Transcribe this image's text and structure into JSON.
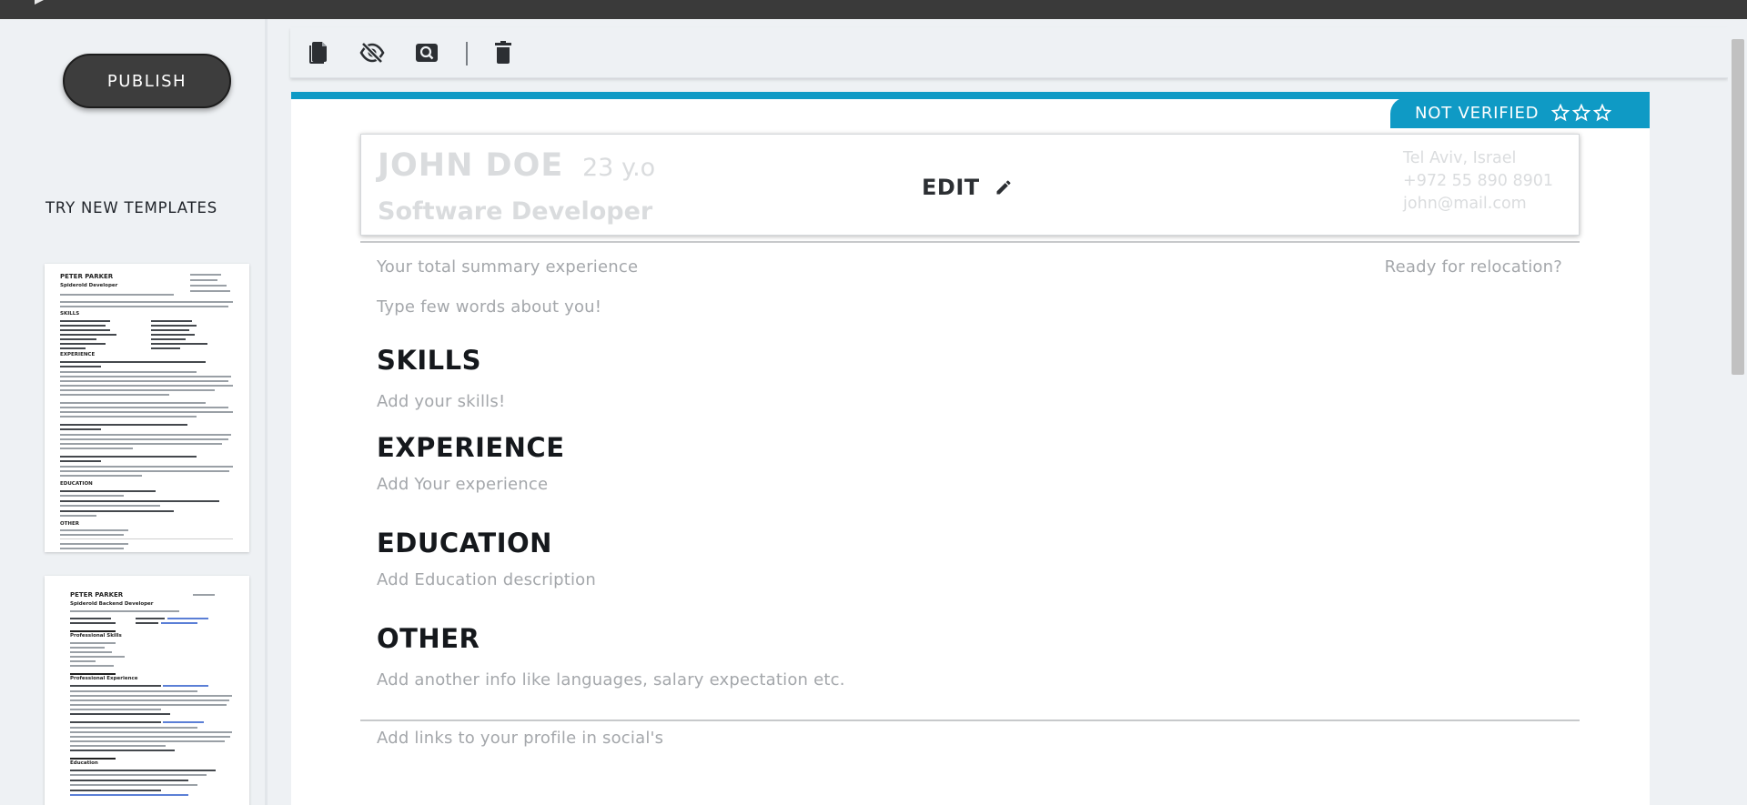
{
  "sidebar": {
    "publish_label": "PUBLISH",
    "templates_heading": "TRY NEW TEMPLATES",
    "templates": [
      {
        "name": "PETER PARKER",
        "role": "Spiderold Developer",
        "sections": [
          "SKILLS",
          "EXPERIENCE",
          "EDUCATION",
          "OTHER"
        ]
      },
      {
        "name": "PETER PARKER",
        "role": "Spiderold Backend Developer",
        "sections": [
          "Professional Skills",
          "Professional Experience",
          "Education"
        ]
      }
    ]
  },
  "toolbar": {
    "icons": [
      "copy-icon",
      "eye-off-icon",
      "search-icon",
      "trash-icon"
    ]
  },
  "resume": {
    "verification": "NOT VERIFIED",
    "star_count": 3,
    "header": {
      "name": "JOHN DOE",
      "age": "23 y.o",
      "title": "Software Developer",
      "edit_label": "EDIT",
      "location": "Tel Aviv, Israel",
      "phone": "+972 55 890 8901",
      "email": "john@mail.com"
    },
    "summary_placeholder": "Your total summary experience",
    "relocation_placeholder": "Ready for relocation?",
    "about_placeholder": "Type few words about you!",
    "sections": {
      "skills": {
        "title": "SKILLS",
        "placeholder": "Add your skills!"
      },
      "experience": {
        "title": "EXPERIENCE",
        "placeholder": "Add Your experience"
      },
      "education": {
        "title": "EDUCATION",
        "placeholder": "Add Education description"
      },
      "other": {
        "title": "OTHER",
        "placeholder": "Add another info like languages, salary expectation etc."
      }
    },
    "links_placeholder": "Add links to your profile in social's"
  },
  "colors": {
    "accent": "#0f9ac5",
    "topbar": "#3a3a3a",
    "publish_button": "#3d3d3d",
    "placeholder_text": "#a4a7ab",
    "faded_header_text": "#dadcde"
  }
}
